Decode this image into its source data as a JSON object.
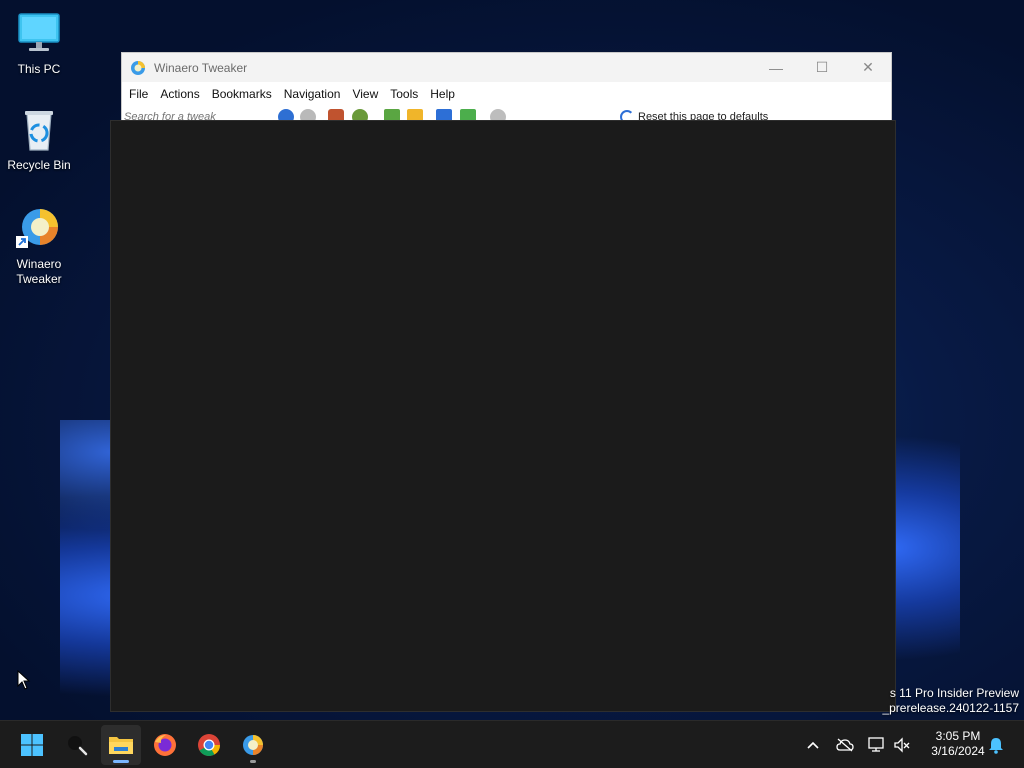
{
  "desktop": {
    "icons": [
      {
        "label": "This PC",
        "icon": "monitor-icon"
      },
      {
        "label": "Recycle Bin",
        "icon": "recycle-bin-icon"
      },
      {
        "label": "Winaero Tweaker",
        "icon": "winaero-tweaker-icon"
      }
    ],
    "watermark": {
      "line1": "s 11 Pro Insider Preview",
      "line2": "_prerelease.240122-1157"
    }
  },
  "window": {
    "title": "Winaero Tweaker",
    "menu": [
      "File",
      "Actions",
      "Bookmarks",
      "Navigation",
      "View",
      "Tools",
      "Help"
    ],
    "toolbar": {
      "search_placeholder": "Search for a tweak",
      "reset_label": "Reset this page to defaults"
    }
  },
  "taskbar": {
    "apps": [
      {
        "name": "start",
        "icon": "windows-start-icon"
      },
      {
        "name": "search",
        "icon": "search-icon"
      },
      {
        "name": "file-explorer",
        "icon": "folder-icon",
        "active": true
      },
      {
        "name": "firefox",
        "icon": "firefox-icon"
      },
      {
        "name": "chrome",
        "icon": "chrome-icon"
      },
      {
        "name": "winaero-tweaker",
        "icon": "winaero-tweaker-icon",
        "running": true
      }
    ],
    "tray": [
      "chevron-up-icon",
      "onedrive-icon",
      "network-icon",
      "speaker-muted-icon"
    ],
    "clock": {
      "time": "3:05 PM",
      "date": "3/16/2024"
    },
    "notification_icon": "bell-icon"
  },
  "colors": {
    "accent": "#7ab6ff",
    "taskbar_bg": "#1c1c1c",
    "panel_bg": "#1b1b1b"
  }
}
